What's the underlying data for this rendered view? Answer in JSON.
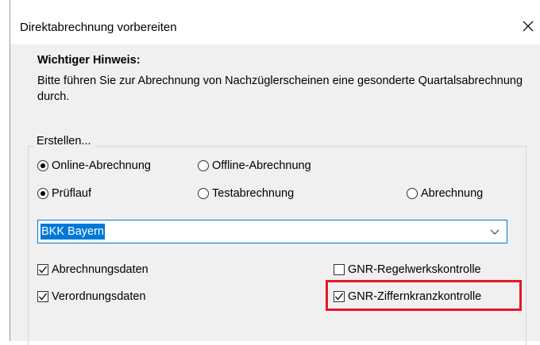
{
  "dialog": {
    "title": "Direktabrechnung vorbereiten",
    "close_icon": "close-icon"
  },
  "notice": {
    "heading": "Wichtiger Hinweis:",
    "text": "Bitte führen Sie zur Abrechnung von Nachzüglerscheinen eine gesonderte Quartalsabrechnung durch."
  },
  "group": {
    "title": "Erstellen...",
    "mode_options": [
      {
        "label": "Online-Abrechnung",
        "selected": true
      },
      {
        "label": "Offline-Abrechnung",
        "selected": false
      }
    ],
    "run_options": [
      {
        "label": "Prüflauf",
        "selected": true
      },
      {
        "label": "Testabrechnung",
        "selected": false
      },
      {
        "label": "Abrechnung",
        "selected": false
      }
    ],
    "insurer_select": {
      "value": "BKK Bayern"
    },
    "checkboxes": [
      {
        "label": "Abrechnungsdaten",
        "checked": true
      },
      {
        "label": "Verordnungsdaten",
        "checked": true
      },
      {
        "label": "GNR-Regelwerkskontrolle",
        "checked": false
      },
      {
        "label": "GNR-Ziffernkranzkontrolle",
        "checked": true
      }
    ]
  },
  "colors": {
    "accent": "#0078d7",
    "highlight": "#e8152b",
    "dialog_bg": "#f0f0f0"
  }
}
